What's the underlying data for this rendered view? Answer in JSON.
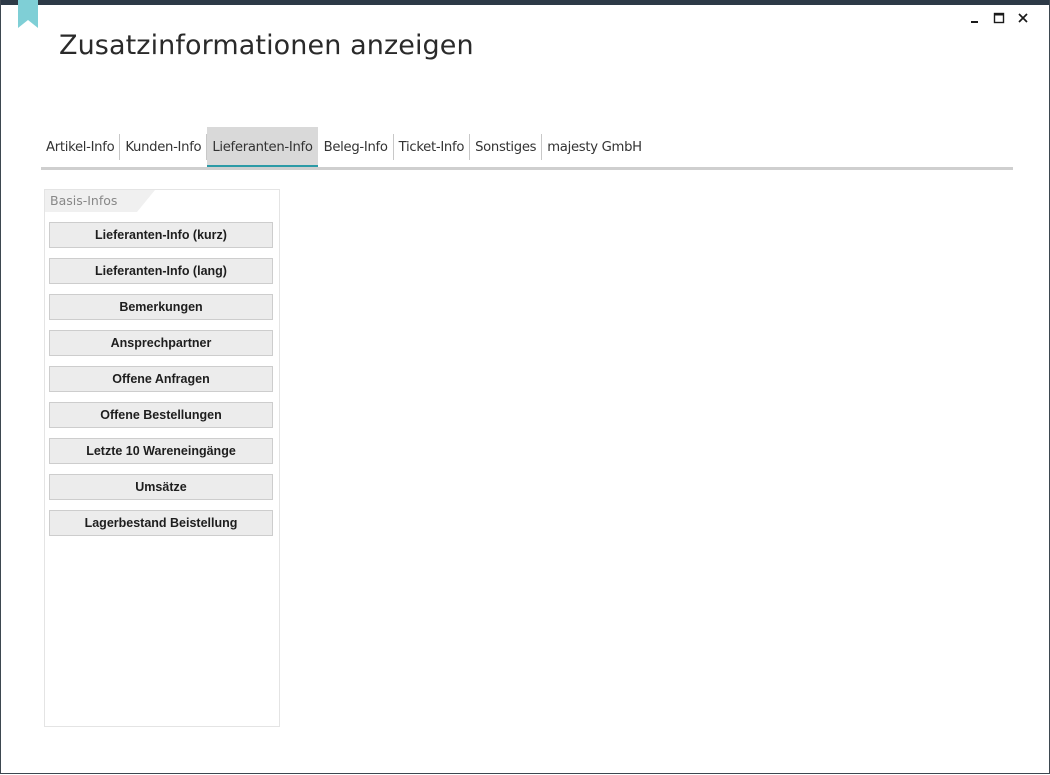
{
  "window": {
    "title": "Zusatzinformationen anzeigen",
    "accent_color": "#2b9aa6",
    "top_strip_color": "#2d3a47",
    "controls": {
      "minimize_icon": "minimize-icon",
      "maximize_icon": "maximize-icon",
      "close_icon": "close-icon"
    }
  },
  "tabs": [
    {
      "label": "Artikel-Info",
      "active": false
    },
    {
      "label": "Kunden-Info",
      "active": false
    },
    {
      "label": "Lieferanten-Info",
      "active": true
    },
    {
      "label": "Beleg-Info",
      "active": false
    },
    {
      "label": "Ticket-Info",
      "active": false
    },
    {
      "label": "Sonstiges",
      "active": false
    },
    {
      "label": "majesty GmbH",
      "active": false
    }
  ],
  "panel": {
    "header": "Basis-Infos",
    "buttons": [
      {
        "label": "Lieferanten-Info (kurz)"
      },
      {
        "label": "Lieferanten-Info (lang)"
      },
      {
        "label": "Bemerkungen"
      },
      {
        "label": "Ansprechpartner"
      },
      {
        "label": "Offene Anfragen"
      },
      {
        "label": "Offene Bestellungen"
      },
      {
        "label": "Letzte 10 Wareneingänge"
      },
      {
        "label": "Umsätze"
      },
      {
        "label": "Lagerbestand Beistellung"
      }
    ]
  }
}
